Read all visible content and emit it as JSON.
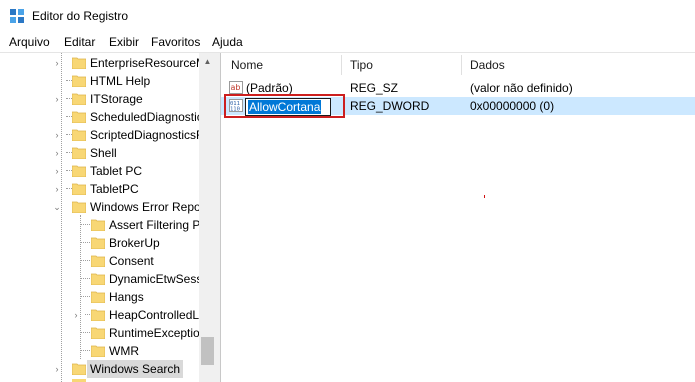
{
  "window": {
    "title": "Editor do Registro"
  },
  "menu": [
    "Arquivo",
    "Editar",
    "Exibir",
    "Favoritos",
    "Ajuda"
  ],
  "tree": {
    "items": [
      {
        "label": "EnterpriseResourceM",
        "level": 1,
        "expander": "›"
      },
      {
        "label": "HTML Help",
        "level": 1,
        "expander": ""
      },
      {
        "label": "ITStorage",
        "level": 1,
        "expander": "›"
      },
      {
        "label": "ScheduledDiagnostic",
        "level": 1,
        "expander": ""
      },
      {
        "label": "ScriptedDiagnosticsF",
        "level": 1,
        "expander": "›"
      },
      {
        "label": "Shell",
        "level": 1,
        "expander": "›"
      },
      {
        "label": "Tablet PC",
        "level": 1,
        "expander": "›"
      },
      {
        "label": "TabletPC",
        "level": 1,
        "expander": "›"
      },
      {
        "label": "Windows Error Repo",
        "level": 1,
        "expander": "⌄"
      },
      {
        "label": "Assert Filtering P",
        "level": 2,
        "expander": ""
      },
      {
        "label": "BrokerUp",
        "level": 2,
        "expander": ""
      },
      {
        "label": "Consent",
        "level": 2,
        "expander": ""
      },
      {
        "label": "DynamicEtwSess",
        "level": 2,
        "expander": ""
      },
      {
        "label": "Hangs",
        "level": 2,
        "expander": ""
      },
      {
        "label": "HeapControlledL",
        "level": 2,
        "expander": "›"
      },
      {
        "label": "RuntimeExceptio",
        "level": 2,
        "expander": ""
      },
      {
        "label": "WMR",
        "level": 2,
        "expander": ""
      },
      {
        "label": "Windows Search",
        "level": 1,
        "expander": "›",
        "selected": true
      }
    ]
  },
  "list": {
    "columns": {
      "name": "Nome",
      "type": "Tipo",
      "data": "Dados"
    },
    "rows": [
      {
        "name": "(Padrão)",
        "type": "REG_SZ",
        "data": "(valor não definido)",
        "icon": "string-value-icon"
      },
      {
        "name": "AllowCortana",
        "type": "REG_DWORD",
        "data": "0x00000000 (0)",
        "icon": "dword-value-icon",
        "editing": true
      }
    ]
  },
  "colors": {
    "selection": "#cce8ff",
    "edit_highlight": "#0078d7",
    "annotation": "#cc1f1f",
    "folder": "#f8d775"
  }
}
